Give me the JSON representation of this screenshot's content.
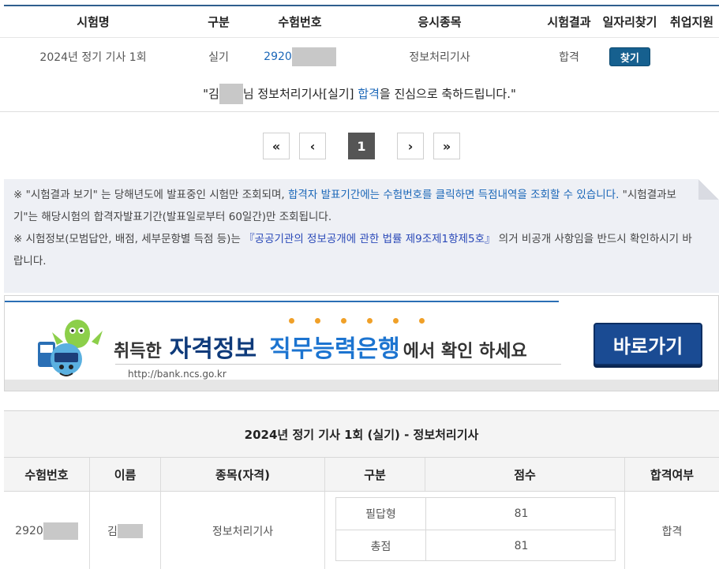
{
  "results_table": {
    "headers": [
      "시험명",
      "구분",
      "수험번호",
      "응시종목",
      "시험결과",
      "일자리찾기",
      "취업지원"
    ],
    "row": {
      "exam_name": "2024년 정기 기사 1회",
      "type": "실기",
      "exam_number_prefix": "2920",
      "item": "정보처리기사",
      "result": "합격",
      "job_button": "찾기"
    }
  },
  "congrats": {
    "quote_open": "\"",
    "name_prefix": "김",
    "middle": "님 정보처리기사[실기] ",
    "highlight": "합격",
    "end": "을 진심으로 축하드립니다.\""
  },
  "pagination": {
    "first": "«",
    "prev": "‹",
    "current": "1",
    "next": "›",
    "last": "»"
  },
  "notices": {
    "note1": {
      "mark": "※",
      "part1": " \"시험결과 보기\" 는 당해년도에 발표중인 시험만 조회되며, ",
      "link": "합격자 발표기간에는 수험번호를 클릭하면 득점내역을 조회할 수 있습니다.",
      "part2": " \"시험결과보기\"는 해당시험의 합격자발표기간(발표일로부터 60일간)만 조회됩니다."
    },
    "note2": {
      "mark": "※",
      "part1": " 시험정보(모범답안, 배점, 세부문항별 득점 등)는 ",
      "law": "『공공기관의 정보공개에 관한 법률 제9조제1항제5호』",
      "part2": " 의거 비공개 사항임을 반드시 확인하시기 바랍니다."
    }
  },
  "banner": {
    "text1": "취득한",
    "text2": "자격정보",
    "text3": "직무능력은행",
    "text4": "에서 확인 하세요",
    "url": "http://bank.ncs.go.kr",
    "button": "바로가기"
  },
  "detail": {
    "title": "2024년 정기 기사 1회 (실기) - 정보처리기사",
    "headers": [
      "수험번호",
      "이름",
      "종목(자격)",
      "구분",
      "점수",
      "합격여부"
    ],
    "exam_number_prefix": "2920",
    "name_prefix": "김",
    "item": "정보처리기사",
    "scores": [
      {
        "label": "필답형",
        "value": "81"
      },
      {
        "label": "총점",
        "value": "81"
      }
    ],
    "pass": "합격"
  },
  "colors": {
    "accent": "#1b67b8",
    "header_line": "#2f5e8e",
    "button": "#16608f",
    "notice_bg": "#eef0f5"
  }
}
